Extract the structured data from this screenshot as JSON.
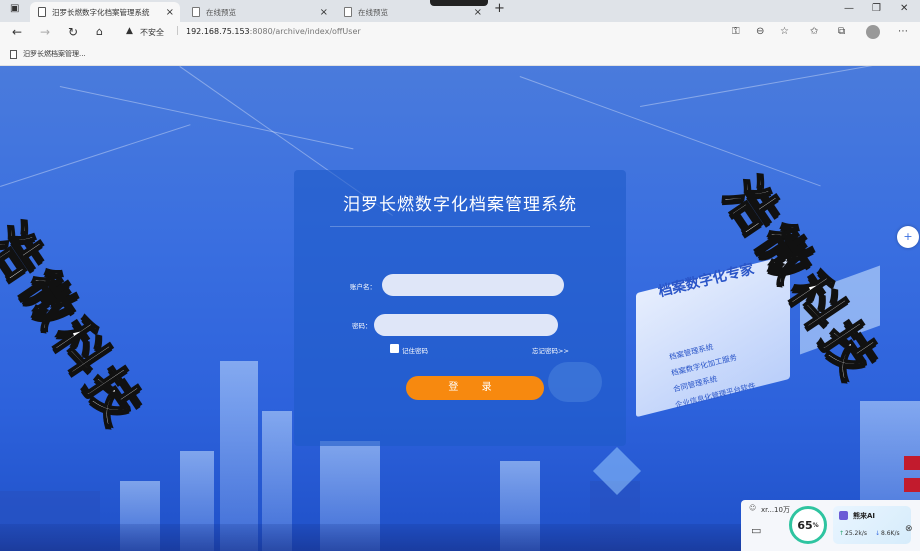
{
  "browser": {
    "tabs": [
      {
        "title": "汨罗长燃数字化档案管理系统",
        "active": true
      },
      {
        "title": "在线预览",
        "active": false
      },
      {
        "title": "在线预览",
        "active": false
      }
    ],
    "security_label": "不安全",
    "url_host": "192.168.75.153",
    "url_path": ":8080/archive/index/offUser",
    "favorite": "汨罗长燃档案管理..."
  },
  "watermark": "浩微科技",
  "login": {
    "title": "汨罗长燃数字化档案管理系统",
    "username_label": "账户名：",
    "password_label": "密码：",
    "username_value": "",
    "password_value": "",
    "remember_label": "记住密码",
    "forgot_label": "忘记密码>>",
    "submit_label": "登 录"
  },
  "promo": {
    "title": "档案数字化专家",
    "items": [
      "档案管理系统",
      "档案数字化加工服务",
      "合同管理系统",
      "企业信息化管理平台软件"
    ]
  },
  "widget": {
    "user_text": "xr...10万",
    "percent": "65",
    "percent_unit": "%",
    "ai_name": "熊来AI",
    "upload": "25.2k/s",
    "download": "8.6K/s"
  },
  "colors": {
    "accent_button": "#f7890f",
    "page_blue": "#3a6fe0"
  }
}
